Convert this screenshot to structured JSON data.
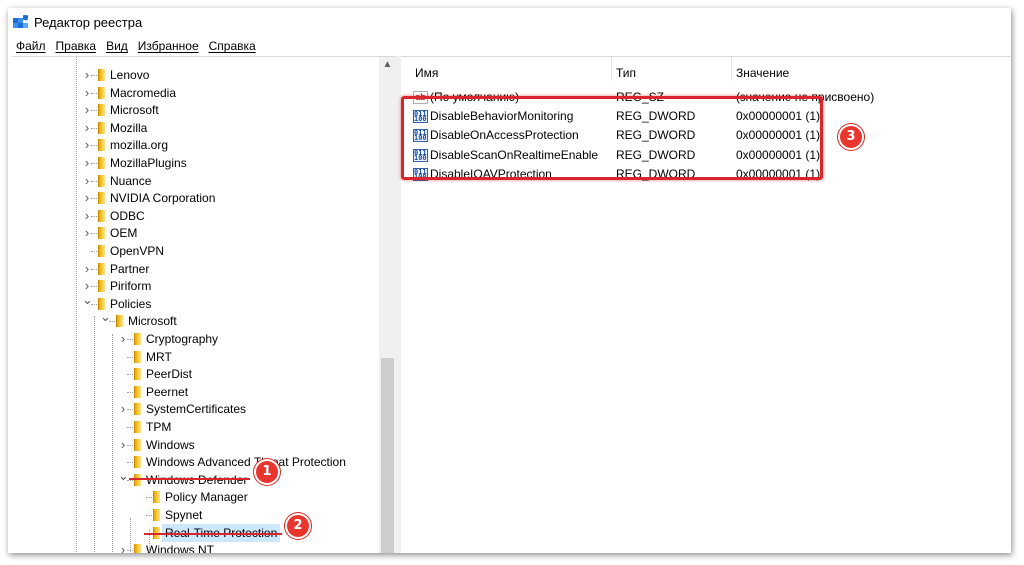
{
  "window": {
    "title": "Редактор реестра"
  },
  "menu": [
    "Файл",
    "Правка",
    "Вид",
    "Избранное",
    "Справка"
  ],
  "tree": [
    {
      "label": "Lenovo",
      "level": 0,
      "expander": "collapsed"
    },
    {
      "label": "Macromedia",
      "level": 0,
      "expander": "collapsed"
    },
    {
      "label": "Microsoft",
      "level": 0,
      "expander": "collapsed"
    },
    {
      "label": "Mozilla",
      "level": 0,
      "expander": "collapsed"
    },
    {
      "label": "mozilla.org",
      "level": 0,
      "expander": "collapsed"
    },
    {
      "label": "MozillaPlugins",
      "level": 0,
      "expander": "collapsed"
    },
    {
      "label": "Nuance",
      "level": 0,
      "expander": "collapsed"
    },
    {
      "label": "NVIDIA Corporation",
      "level": 0,
      "expander": "collapsed"
    },
    {
      "label": "ODBC",
      "level": 0,
      "expander": "collapsed"
    },
    {
      "label": "OEM",
      "level": 0,
      "expander": "collapsed"
    },
    {
      "label": "OpenVPN",
      "level": 0,
      "expander": "none"
    },
    {
      "label": "Partner",
      "level": 0,
      "expander": "collapsed"
    },
    {
      "label": "Piriform",
      "level": 0,
      "expander": "collapsed"
    },
    {
      "label": "Policies",
      "level": 0,
      "expander": "expanded"
    },
    {
      "label": "Microsoft",
      "level": 1,
      "expander": "expanded"
    },
    {
      "label": "Cryptography",
      "level": 2,
      "expander": "collapsed"
    },
    {
      "label": "MRT",
      "level": 2,
      "expander": "none"
    },
    {
      "label": "PeerDist",
      "level": 2,
      "expander": "none"
    },
    {
      "label": "Peernet",
      "level": 2,
      "expander": "none"
    },
    {
      "label": "SystemCertificates",
      "level": 2,
      "expander": "collapsed"
    },
    {
      "label": "TPM",
      "level": 2,
      "expander": "none"
    },
    {
      "label": "Windows",
      "level": 2,
      "expander": "collapsed"
    },
    {
      "label": "Windows Advanced Threat Protection",
      "level": 2,
      "expander": "none"
    },
    {
      "label": "Windows Defender",
      "level": 2,
      "expander": "expanded"
    },
    {
      "label": "Policy Manager",
      "level": 3,
      "expander": "none"
    },
    {
      "label": "Spynet",
      "level": 3,
      "expander": "none"
    },
    {
      "label": "Real-Time Protection",
      "level": 3,
      "expander": "none",
      "selected": true
    },
    {
      "label": "Windows NT",
      "level": 2,
      "expander": "collapsed"
    }
  ],
  "list": {
    "columns": [
      "Имя",
      "Тип",
      "Значение"
    ],
    "rows": [
      {
        "icon": "string-value-icon",
        "name": "(По умолчанию)",
        "type": "REG_SZ",
        "value": "(значение не присвоено)"
      },
      {
        "icon": "dword-value-icon",
        "name": "DisableBehaviorMonitoring",
        "type": "REG_DWORD",
        "value": "0x00000001 (1)"
      },
      {
        "icon": "dword-value-icon",
        "name": "DisableOnAccessProtection",
        "type": "REG_DWORD",
        "value": "0x00000001 (1)"
      },
      {
        "icon": "dword-value-icon",
        "name": "DisableScanOnRealtimeEnable",
        "type": "REG_DWORD",
        "value": "0x00000001 (1)"
      },
      {
        "icon": "dword-value-icon",
        "name": "DisableIOAVProtection",
        "type": "REG_DWORD",
        "value": "0x00000001 (1)"
      }
    ]
  },
  "annotations": {
    "badge1": "1",
    "badge2": "2",
    "badge3": "3",
    "accent_color": "#d9262c"
  }
}
